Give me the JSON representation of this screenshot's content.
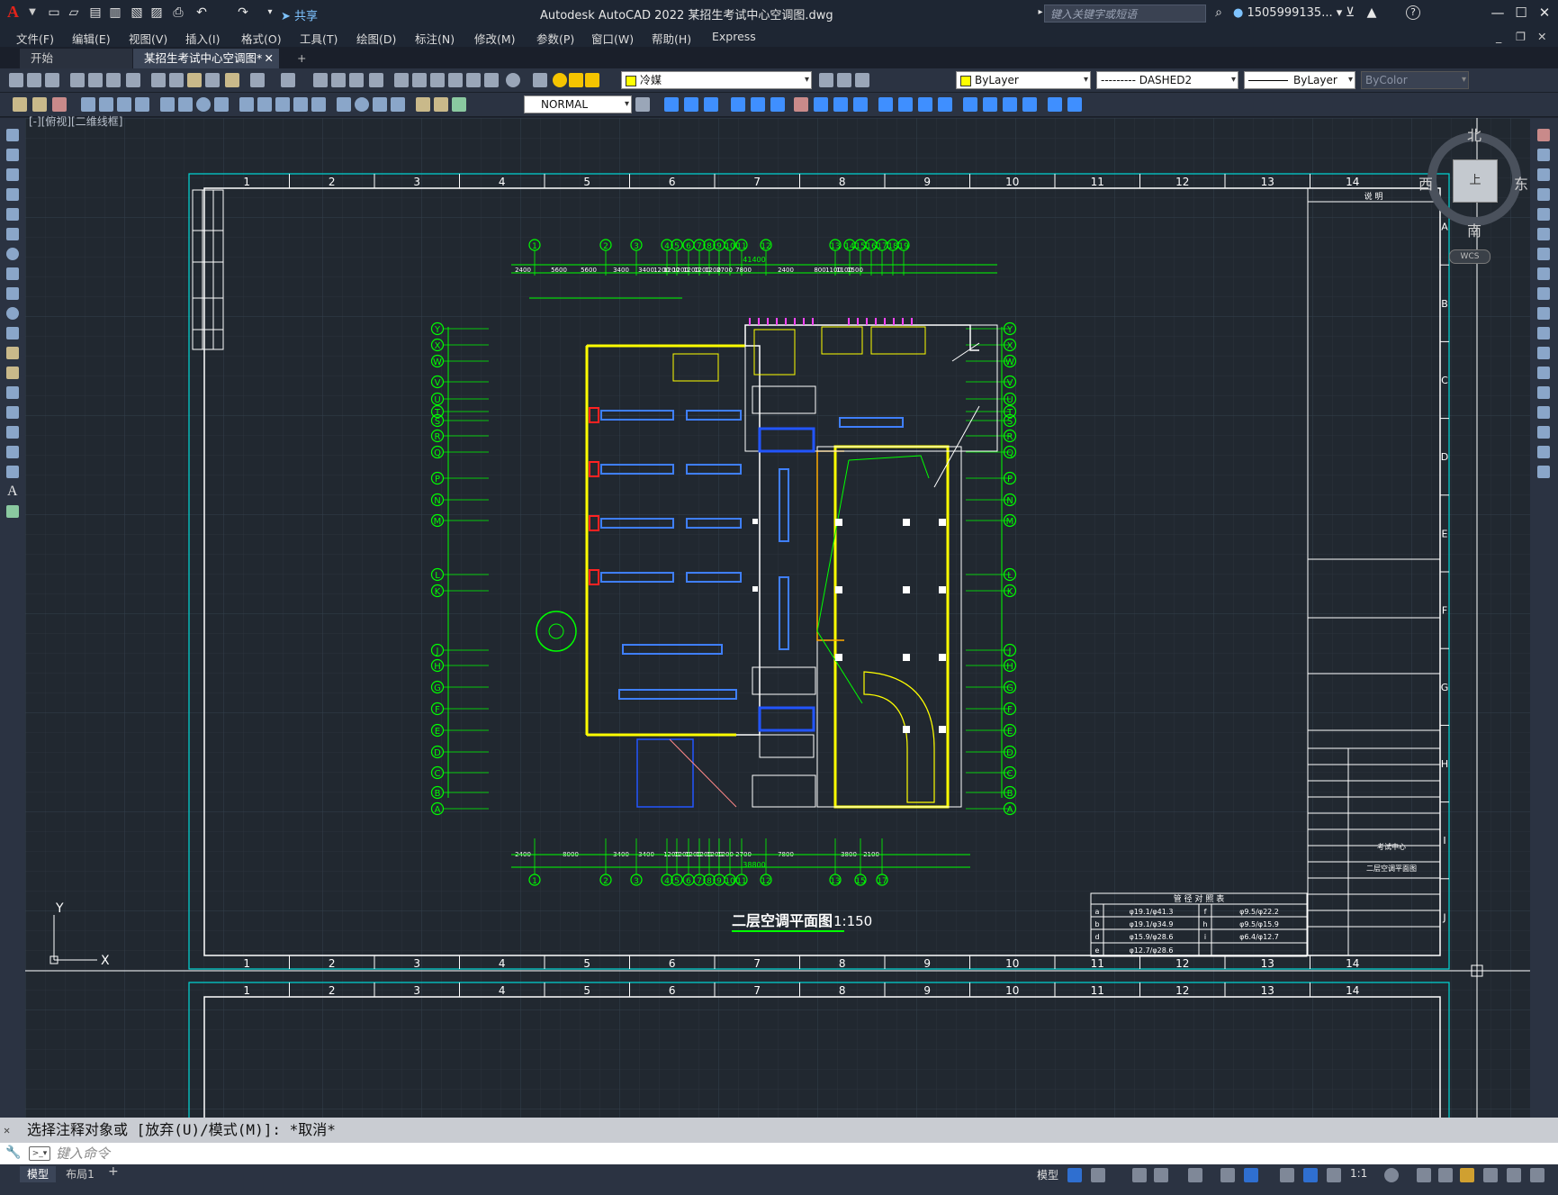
{
  "app": {
    "logo": "A",
    "title": "Autodesk AutoCAD 2022    某招生考试中心空调图.dwg",
    "share_label": "共享",
    "search_placeholder": "键入关键字或短语",
    "user": "1505999135...",
    "window_controls": [
      "minimize-icon",
      "restore-icon",
      "close-icon"
    ]
  },
  "menu": [
    "文件(F)",
    "编辑(E)",
    "视图(V)",
    "插入(I)",
    "格式(O)",
    "工具(T)",
    "绘图(D)",
    "标注(N)",
    "修改(M)",
    "参数(P)",
    "窗口(W)",
    "帮助(H)",
    "Express"
  ],
  "tabs": [
    {
      "label": "开始",
      "active": false
    },
    {
      "label": "某招生考试中心空调图*",
      "active": true
    }
  ],
  "toolbar": {
    "layer": "冷媒",
    "color": "ByLayer",
    "linetype": "--------- DASHED2",
    "lineweight": "ByLayer",
    "plotstyle": "ByColor",
    "textstyle": "NORMAL"
  },
  "viewport": {
    "label": "[-][俯视][二维线框]",
    "compass": {
      "n": "北",
      "s": "南",
      "e": "东",
      "w": "西",
      "top": "上",
      "wcs": "WCS"
    }
  },
  "drawing": {
    "top_cols": [
      "1",
      "2",
      "3",
      "4",
      "5",
      "6",
      "7",
      "8",
      "9",
      "10",
      "11",
      "12",
      "13",
      "14"
    ],
    "row_letters": [
      "A",
      "B",
      "C",
      "D",
      "E",
      "F",
      "G",
      "H",
      "I",
      "J"
    ],
    "plan_title": "二层空调平面图",
    "plan_scale": "1:150",
    "col_axis_top": [
      "1",
      "2",
      "3",
      "4",
      "5",
      "6",
      "7",
      "8",
      "9",
      "10",
      "11",
      "12",
      "13",
      "14",
      "15",
      "16",
      "17",
      "18",
      "19"
    ],
    "col_axis_bottom": [
      "1",
      "2",
      "3",
      "4",
      "5",
      "6",
      "7",
      "8",
      "9",
      "10",
      "11",
      "12",
      "13",
      "15",
      "17"
    ],
    "row_axis": [
      "Y",
      "X",
      "W",
      "V",
      "U",
      "T",
      "S",
      "R",
      "Q",
      "P",
      "N",
      "M",
      "L",
      "K",
      "J",
      "H",
      "G",
      "F",
      "E",
      "D",
      "C",
      "B",
      "A"
    ],
    "dims_top": [
      "2400",
      "5600",
      "5600",
      "3400",
      "3400",
      "1200",
      "1200",
      "1200",
      "1200",
      "1200",
      "1200",
      "2700",
      "7800",
      "2400",
      "800",
      "1100",
      "1100",
      "1500"
    ],
    "dim_total_top": "41400",
    "dims_bottom": [
      "2400",
      "8000",
      "3400",
      "3400",
      "1200",
      "1200",
      "1200",
      "1200",
      "1200",
      "1200",
      "2700",
      "7800",
      "3800",
      "2100"
    ],
    "dim_total_bottom": "38800",
    "pipe_table": {
      "title": "管 径 对 照 表",
      "rows": [
        [
          "a",
          "φ19.1/φ41.3",
          "f",
          "φ9.5/φ22.2"
        ],
        [
          "b",
          "φ19.1/φ34.9",
          "h",
          "φ9.5/φ15.9"
        ],
        [
          "d",
          "φ15.9/φ28.6",
          "i",
          "φ6.4/φ12.7"
        ],
        [
          "e",
          "φ12.7/φ28.6",
          "",
          ""
        ]
      ]
    },
    "notes_header": "说 明",
    "title_block": {
      "drawing_name": "二层空调平面图",
      "project": "考试中心"
    }
  },
  "command": {
    "history": "选择注释对象或 [放弃(U)/模式(M)]: *取消*",
    "prompt": "键入命令"
  },
  "status": {
    "tabs": [
      "模型",
      "布局1"
    ],
    "model_label": "模型",
    "scale": "1:1"
  },
  "colors": {
    "accent": "#00d8d8",
    "wall": "#ffff00",
    "axis": "#00ff00",
    "duct": "#3f7fff"
  }
}
